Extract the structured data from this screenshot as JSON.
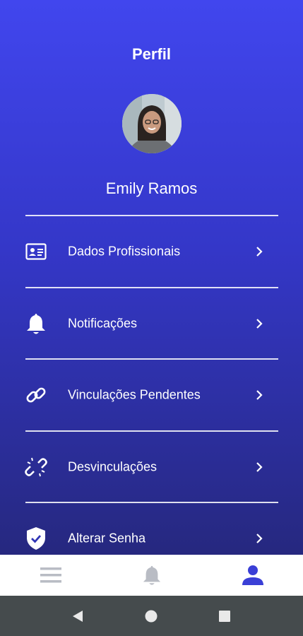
{
  "header": {
    "title": "Perfil"
  },
  "profile": {
    "name": "Emily Ramos"
  },
  "menu": [
    {
      "label": "Dados Profissionais",
      "icon": "id-card-icon"
    },
    {
      "label": "Notificações",
      "icon": "bell-icon"
    },
    {
      "label": "Vinculações Pendentes",
      "icon": "link-icon"
    },
    {
      "label": "Desvinculações",
      "icon": "unlink-icon"
    },
    {
      "label": "Alterar Senha",
      "icon": "shield-check-icon"
    }
  ],
  "tabbar": {
    "items": [
      {
        "icon": "menu-icon",
        "active": false
      },
      {
        "icon": "bell-icon",
        "active": false
      },
      {
        "icon": "person-icon",
        "active": true
      }
    ]
  },
  "colors": {
    "primary": "#4146ee",
    "gradient_end": "#26287f",
    "tab_active": "#3a3fd6",
    "tab_inactive": "#b9bcc4"
  }
}
